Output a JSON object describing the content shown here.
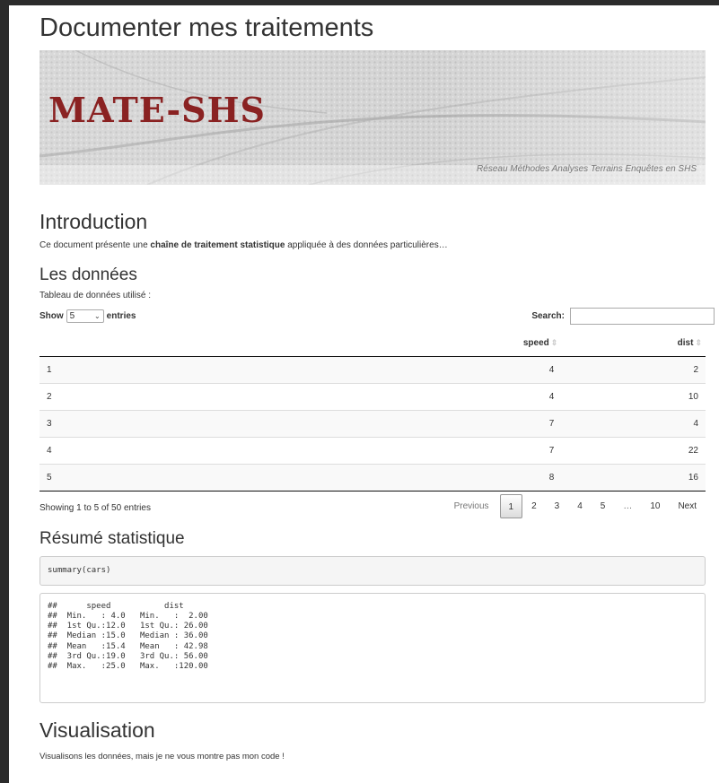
{
  "document": {
    "title": "Documenter mes traitements",
    "banner": {
      "logo_text": "MATE-SHS",
      "tagline": "Réseau Méthodes Analyses Terrains Enquêtes en SHS"
    },
    "introduction": {
      "heading": "Introduction",
      "text_before": "Ce document présente une ",
      "text_bold": "chaîne de traitement statistique",
      "text_after": " appliquée à des données particulières…"
    },
    "data_section": {
      "heading": "Les données",
      "caption": "Tableau de données utilisé :"
    },
    "summary_section": {
      "heading": "Résumé statistique",
      "code": "summary(cars)",
      "output_lines": [
        "##      speed           dist       ",
        "##  Min.   : 4.0   Min.   :  2.00  ",
        "##  1st Qu.:12.0   1st Qu.: 26.00  ",
        "##  Median :15.0   Median : 36.00  ",
        "##  Mean   :15.4   Mean   : 42.98  ",
        "##  3rd Qu.:19.0   3rd Qu.: 56.00  ",
        "##  Max.   :25.0   Max.   :120.00  "
      ]
    },
    "visualisation_section": {
      "heading": "Visualisation",
      "text": "Visualisons les données, mais je ne vous montre pas mon code !"
    }
  },
  "datatable": {
    "show_label": "Show",
    "entries_label": "entries",
    "length_value": "5",
    "search_label": "Search:",
    "search_value": "",
    "columns": [
      "",
      "speed",
      "dist"
    ],
    "rows": [
      [
        "1",
        "4",
        "2"
      ],
      [
        "2",
        "4",
        "10"
      ],
      [
        "3",
        "7",
        "4"
      ],
      [
        "4",
        "7",
        "22"
      ],
      [
        "5",
        "8",
        "16"
      ]
    ],
    "info": "Showing 1 to 5 of 50 entries",
    "pagination": {
      "previous": "Previous",
      "pages": [
        "1",
        "2",
        "3",
        "4",
        "5"
      ],
      "ellipsis": "…",
      "last": "10",
      "next": "Next",
      "current": "1"
    }
  }
}
